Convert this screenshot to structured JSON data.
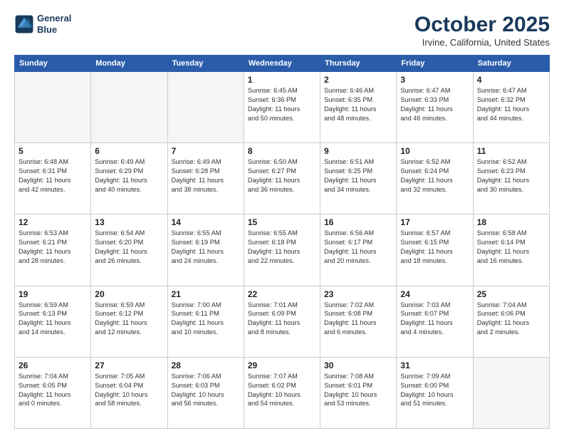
{
  "logo": {
    "line1": "General",
    "line2": "Blue"
  },
  "title": "October 2025",
  "location": "Irvine, California, United States",
  "weekdays": [
    "Sunday",
    "Monday",
    "Tuesday",
    "Wednesday",
    "Thursday",
    "Friday",
    "Saturday"
  ],
  "weeks": [
    [
      {
        "day": "",
        "info": ""
      },
      {
        "day": "",
        "info": ""
      },
      {
        "day": "",
        "info": ""
      },
      {
        "day": "1",
        "info": "Sunrise: 6:45 AM\nSunset: 6:36 PM\nDaylight: 11 hours\nand 50 minutes."
      },
      {
        "day": "2",
        "info": "Sunrise: 6:46 AM\nSunset: 6:35 PM\nDaylight: 11 hours\nand 48 minutes."
      },
      {
        "day": "3",
        "info": "Sunrise: 6:47 AM\nSunset: 6:33 PM\nDaylight: 11 hours\nand 46 minutes."
      },
      {
        "day": "4",
        "info": "Sunrise: 6:47 AM\nSunset: 6:32 PM\nDaylight: 11 hours\nand 44 minutes."
      }
    ],
    [
      {
        "day": "5",
        "info": "Sunrise: 6:48 AM\nSunset: 6:31 PM\nDaylight: 11 hours\nand 42 minutes."
      },
      {
        "day": "6",
        "info": "Sunrise: 6:49 AM\nSunset: 6:29 PM\nDaylight: 11 hours\nand 40 minutes."
      },
      {
        "day": "7",
        "info": "Sunrise: 6:49 AM\nSunset: 6:28 PM\nDaylight: 11 hours\nand 38 minutes."
      },
      {
        "day": "8",
        "info": "Sunrise: 6:50 AM\nSunset: 6:27 PM\nDaylight: 11 hours\nand 36 minutes."
      },
      {
        "day": "9",
        "info": "Sunrise: 6:51 AM\nSunset: 6:25 PM\nDaylight: 11 hours\nand 34 minutes."
      },
      {
        "day": "10",
        "info": "Sunrise: 6:52 AM\nSunset: 6:24 PM\nDaylight: 11 hours\nand 32 minutes."
      },
      {
        "day": "11",
        "info": "Sunrise: 6:52 AM\nSunset: 6:23 PM\nDaylight: 11 hours\nand 30 minutes."
      }
    ],
    [
      {
        "day": "12",
        "info": "Sunrise: 6:53 AM\nSunset: 6:21 PM\nDaylight: 11 hours\nand 28 minutes."
      },
      {
        "day": "13",
        "info": "Sunrise: 6:54 AM\nSunset: 6:20 PM\nDaylight: 11 hours\nand 26 minutes."
      },
      {
        "day": "14",
        "info": "Sunrise: 6:55 AM\nSunset: 6:19 PM\nDaylight: 11 hours\nand 24 minutes."
      },
      {
        "day": "15",
        "info": "Sunrise: 6:55 AM\nSunset: 6:18 PM\nDaylight: 11 hours\nand 22 minutes."
      },
      {
        "day": "16",
        "info": "Sunrise: 6:56 AM\nSunset: 6:17 PM\nDaylight: 11 hours\nand 20 minutes."
      },
      {
        "day": "17",
        "info": "Sunrise: 6:57 AM\nSunset: 6:15 PM\nDaylight: 11 hours\nand 18 minutes."
      },
      {
        "day": "18",
        "info": "Sunrise: 6:58 AM\nSunset: 6:14 PM\nDaylight: 11 hours\nand 16 minutes."
      }
    ],
    [
      {
        "day": "19",
        "info": "Sunrise: 6:59 AM\nSunset: 6:13 PM\nDaylight: 11 hours\nand 14 minutes."
      },
      {
        "day": "20",
        "info": "Sunrise: 6:59 AM\nSunset: 6:12 PM\nDaylight: 11 hours\nand 12 minutes."
      },
      {
        "day": "21",
        "info": "Sunrise: 7:00 AM\nSunset: 6:11 PM\nDaylight: 11 hours\nand 10 minutes."
      },
      {
        "day": "22",
        "info": "Sunrise: 7:01 AM\nSunset: 6:09 PM\nDaylight: 11 hours\nand 8 minutes."
      },
      {
        "day": "23",
        "info": "Sunrise: 7:02 AM\nSunset: 6:08 PM\nDaylight: 11 hours\nand 6 minutes."
      },
      {
        "day": "24",
        "info": "Sunrise: 7:03 AM\nSunset: 6:07 PM\nDaylight: 11 hours\nand 4 minutes."
      },
      {
        "day": "25",
        "info": "Sunrise: 7:04 AM\nSunset: 6:06 PM\nDaylight: 11 hours\nand 2 minutes."
      }
    ],
    [
      {
        "day": "26",
        "info": "Sunrise: 7:04 AM\nSunset: 6:05 PM\nDaylight: 11 hours\nand 0 minutes."
      },
      {
        "day": "27",
        "info": "Sunrise: 7:05 AM\nSunset: 6:04 PM\nDaylight: 10 hours\nand 58 minutes."
      },
      {
        "day": "28",
        "info": "Sunrise: 7:06 AM\nSunset: 6:03 PM\nDaylight: 10 hours\nand 56 minutes."
      },
      {
        "day": "29",
        "info": "Sunrise: 7:07 AM\nSunset: 6:02 PM\nDaylight: 10 hours\nand 54 minutes."
      },
      {
        "day": "30",
        "info": "Sunrise: 7:08 AM\nSunset: 6:01 PM\nDaylight: 10 hours\nand 53 minutes."
      },
      {
        "day": "31",
        "info": "Sunrise: 7:09 AM\nSunset: 6:00 PM\nDaylight: 10 hours\nand 51 minutes."
      },
      {
        "day": "",
        "info": ""
      }
    ]
  ]
}
